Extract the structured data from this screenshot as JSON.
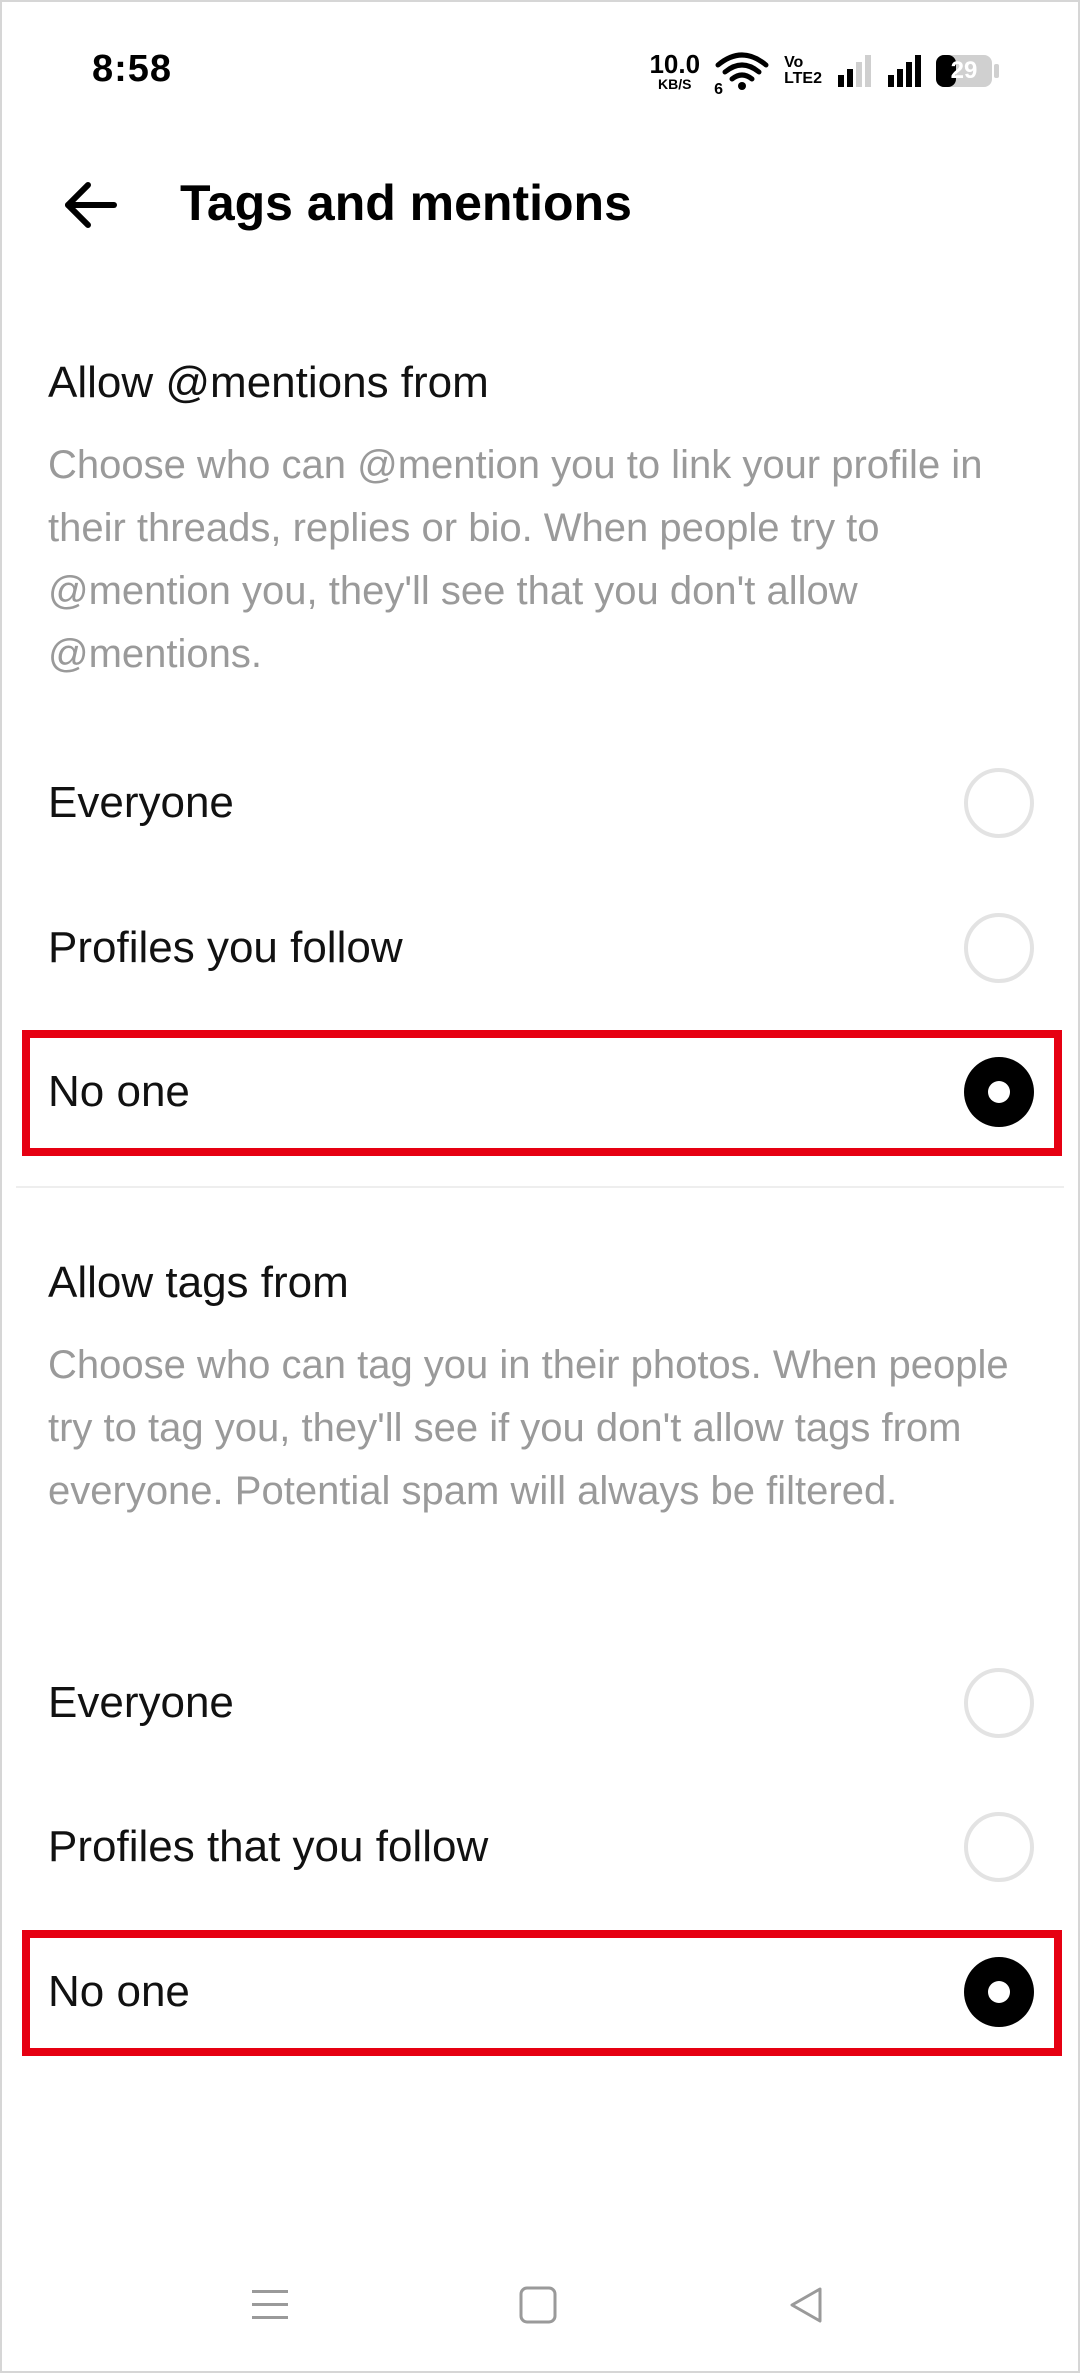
{
  "status_bar": {
    "time": "8:58",
    "net_speed_value": "10.0",
    "net_speed_unit": "KB/S",
    "wifi_label": "6",
    "volte_top": "Vo",
    "volte_bottom": "LTE2",
    "battery": "29"
  },
  "header": {
    "title": "Tags and mentions"
  },
  "mentions": {
    "title": "Allow @mentions from",
    "description": "Choose who can @mention you to link your profile in their threads, replies or bio. When people try to @mention you, they'll see that you don't allow @mentions.",
    "options": [
      {
        "label": "Everyone",
        "selected": false
      },
      {
        "label": "Profiles you follow",
        "selected": false
      },
      {
        "label": "No one",
        "selected": true
      }
    ]
  },
  "tags": {
    "title": "Allow tags from",
    "description": "Choose who can tag you in their photos. When people try to tag you, they'll see if you don't allow tags from everyone. Potential spam will always be filtered.",
    "options": [
      {
        "label": "Everyone",
        "selected": false
      },
      {
        "label": "Profiles that you follow",
        "selected": false
      },
      {
        "label": "No one",
        "selected": true
      }
    ]
  },
  "colors": {
    "highlight": "#e60012",
    "description_text": "#9a9a9a",
    "radio_selected": "#000000",
    "radio_unselected_border": "#e3e3e3"
  },
  "nav_bar": {
    "icons": [
      "menu-icon",
      "home-square-icon",
      "back-triangle-icon"
    ]
  }
}
